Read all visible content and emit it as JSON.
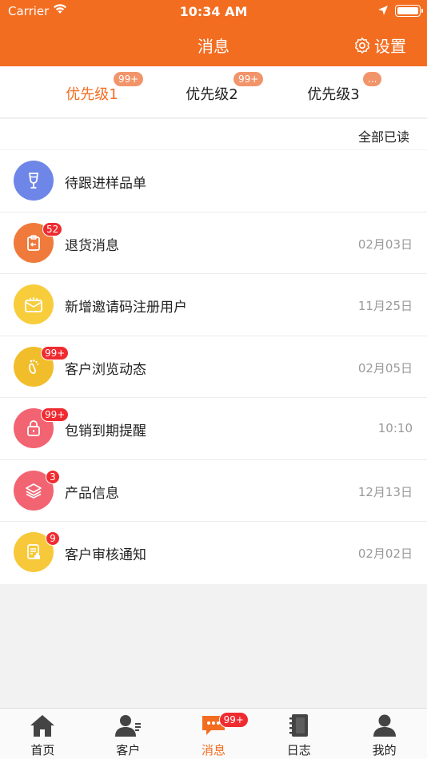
{
  "status": {
    "carrier": "Carrier",
    "time": "10:34 AM"
  },
  "nav": {
    "title": "消息",
    "settings": "设置"
  },
  "tabs": [
    {
      "label": "优先级1",
      "badge": "99+",
      "active": true
    },
    {
      "label": "优先级2",
      "badge": "99+",
      "active": false
    },
    {
      "label": "优先级3",
      "badge": "...",
      "active": false
    }
  ],
  "read_all": "全部已读",
  "messages": [
    {
      "title": "待跟进样品单",
      "date": "",
      "badge": "",
      "icon": "wine-glass-icon",
      "color": "#6e86e8"
    },
    {
      "title": "退货消息",
      "date": "02月03日",
      "badge": "52",
      "icon": "clipboard-return-icon",
      "color": "#ef7a3c"
    },
    {
      "title": "新增邀请码注册用户",
      "date": "11月25日",
      "badge": "",
      "icon": "envelope-icon",
      "color": "#f7cd3c"
    },
    {
      "title": "客户浏览动态",
      "date": "02月05日",
      "badge": "99+",
      "icon": "footprint-icon",
      "color": "#f2bd2a"
    },
    {
      "title": "包销到期提醒",
      "date": "10:10",
      "badge": "99+",
      "icon": "lock-icon",
      "color": "#f26472"
    },
    {
      "title": "产品信息",
      "date": "12月13日",
      "badge": "3",
      "icon": "layers-icon",
      "color": "#f26472"
    },
    {
      "title": "客户审核通知",
      "date": "02月02日",
      "badge": "9",
      "icon": "document-stamp-icon",
      "color": "#f7c83a"
    }
  ],
  "tabbar": [
    {
      "label": "首页",
      "icon": "home-icon"
    },
    {
      "label": "客户",
      "icon": "customer-icon"
    },
    {
      "label": "消息",
      "icon": "message-icon",
      "badge": "99+",
      "active": true
    },
    {
      "label": "日志",
      "icon": "notebook-icon"
    },
    {
      "label": "我的",
      "icon": "profile-icon"
    }
  ],
  "colors": {
    "brand": "#f36d21",
    "badge_red": "#ef2b30",
    "tab_badge": "#f2946a"
  }
}
